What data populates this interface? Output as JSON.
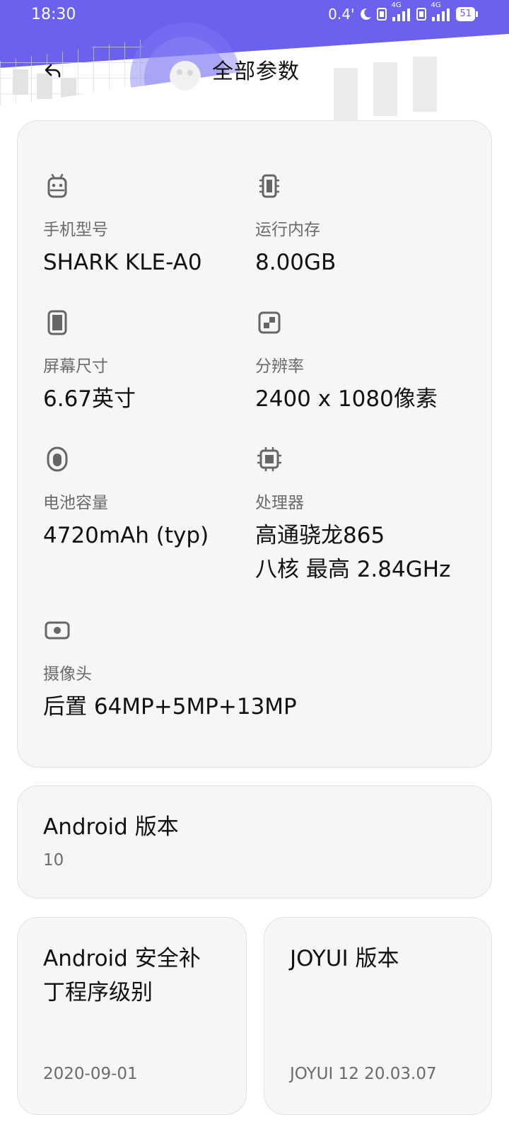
{
  "status_bar": {
    "time": "18:30",
    "net_speed": "0.4'",
    "signal_1_label": "4G",
    "signal_2_label": "4G",
    "battery": "51"
  },
  "header": {
    "title": "全部参数",
    "back_icon": "back-arrow-icon",
    "accent_color": "#6a62ee"
  },
  "specs": {
    "model": {
      "icon": "android-robot-icon",
      "label": "手机型号",
      "value": "SHARK KLE-A0"
    },
    "ram": {
      "icon": "memory-chip-icon",
      "label": "运行内存",
      "value": "8.00GB"
    },
    "screen_size": {
      "icon": "phone-screen-icon",
      "label": "屏幕尺寸",
      "value": "6.67英寸"
    },
    "resolution": {
      "icon": "resolution-icon",
      "label": "分辨率",
      "value": "2400 x 1080像素"
    },
    "battery": {
      "icon": "battery-icon",
      "label": "电池容量",
      "value": "4720mAh (typ)"
    },
    "processor": {
      "icon": "cpu-icon",
      "label": "处理器",
      "value_line1": "高通骁龙865",
      "value_line2": "八核 最高 2.84GHz"
    },
    "camera": {
      "icon": "camera-icon",
      "label": "摄像头",
      "value": "后置 64MP+5MP+13MP"
    }
  },
  "android_version": {
    "title": "Android 版本",
    "value": "10"
  },
  "security_patch": {
    "title_line1": "Android 安全补",
    "title_line2": "丁程序级别",
    "value": "2020-09-01"
  },
  "joyui_version": {
    "title": "JOYUI 版本",
    "value": "JOYUI 12 20.03.07"
  }
}
